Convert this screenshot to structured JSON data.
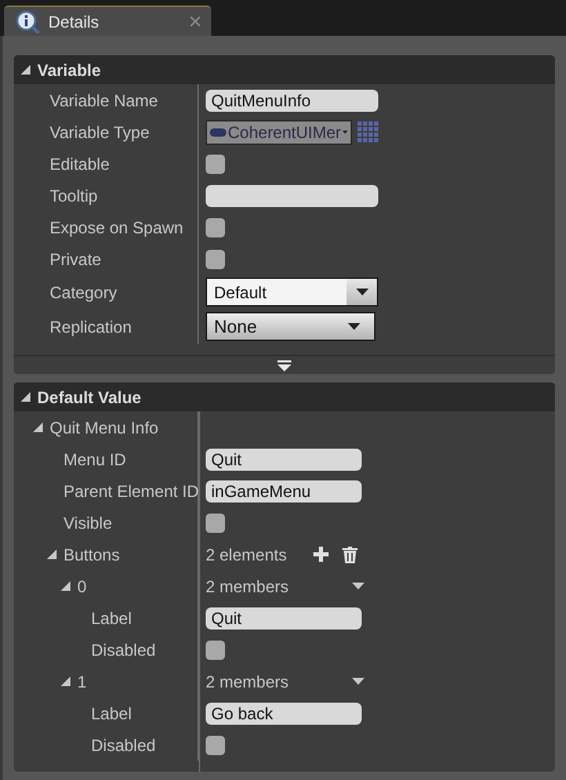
{
  "tab": {
    "title": "Details",
    "closable": true
  },
  "sections": [
    {
      "title": "Variable",
      "expanded": true,
      "has_advanced": true,
      "rows": [
        {
          "kind": "text",
          "label": "Variable Name",
          "value": "QuitMenuInfo"
        },
        {
          "kind": "type",
          "label": "Variable Type",
          "value": "CoherentUIMer"
        },
        {
          "kind": "checkbox",
          "label": "Editable",
          "checked": false
        },
        {
          "kind": "text",
          "label": "Tooltip"
        },
        {
          "kind": "checkbox",
          "label": "Expose on Spawn",
          "checked": false
        },
        {
          "kind": "checkbox",
          "label": "Private",
          "checked": false
        },
        {
          "kind": "combo",
          "label": "Category",
          "value": "Default"
        },
        {
          "kind": "dropdown",
          "label": "Replication",
          "value": "None"
        }
      ]
    },
    {
      "title": "Default Value",
      "expanded": true,
      "rows": [
        {
          "kind": "group",
          "label": "Quit Menu Info",
          "expanded": true,
          "children": [
            {
              "kind": "text",
              "label": "Menu ID",
              "value": "Quit"
            },
            {
              "kind": "text",
              "label": "Parent Element ID",
              "value": "inGameMenu"
            },
            {
              "kind": "checkbox",
              "label": "Visible",
              "checked": false
            },
            {
              "kind": "array",
              "label": "Buttons",
              "value": "2 elements",
              "expanded": true,
              "children": [
                {
                  "kind": "struct",
                  "label": "0",
                  "value": "2 members",
                  "expanded": true,
                  "children": [
                    {
                      "kind": "text",
                      "label": "Label",
                      "value": "Quit"
                    },
                    {
                      "kind": "checkbox",
                      "label": "Disabled",
                      "checked": false
                    }
                  ]
                },
                {
                  "kind": "struct",
                  "label": "1",
                  "value": "2 members",
                  "expanded": true,
                  "children": [
                    {
                      "kind": "text",
                      "label": "Label",
                      "value": "Go back"
                    },
                    {
                      "kind": "checkbox",
                      "label": "Disabled",
                      "checked": false
                    }
                  ]
                }
              ]
            }
          ]
        }
      ]
    }
  ]
}
